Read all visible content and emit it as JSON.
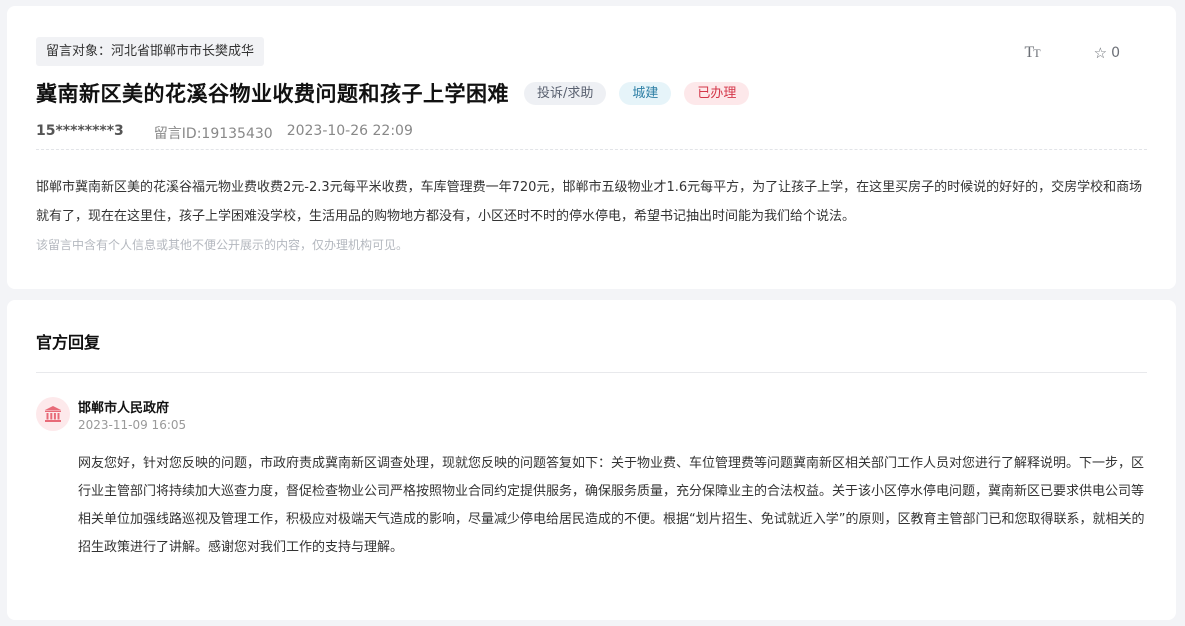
{
  "message": {
    "target": "留言对象：河北省邯郸市市长樊成华",
    "font_toggle": "TT",
    "favorite_count": "0",
    "title": "冀南新区美的花溪谷物业收费问题和孩子上学困难",
    "tags": {
      "type": "投诉/求助",
      "category": "城建",
      "status": "已办理"
    },
    "user": "15********3",
    "message_id": "留言ID:19135430",
    "datetime": "2023-10-26 22:09",
    "content": "邯郸市冀南新区美的花溪谷福元物业费收费2元-2.3元每平米收费，车库管理费一年720元，邯郸市五级物业才1.6元每平方，为了让孩子上学，在这里买房子的时候说的好好的，交房学校和商场就有了，现在在这里住，孩子上学困难没学校，生活用品的购物地方都没有，小区还时不时的停水停电，希望书记抽出时间能为我们给个说法。",
    "privacy_notice": "该留言中含有个人信息或其他不便公开展示的内容，仅办理机构可见。"
  },
  "reply": {
    "heading": "官方回复",
    "org_name": "邯郸市人民政府",
    "datetime": "2023-11-09 16:05",
    "content": "网友您好，针对您反映的问题，市政府责成冀南新区调查处理，现就您反映的问题答复如下：关于物业费、车位管理费等问题冀南新区相关部门工作人员对您进行了解释说明。下一步，区行业主管部门将持续加大巡查力度，督促检查物业公司严格按照物业合同约定提供服务，确保服务质量，充分保障业主的合法权益。关于该小区停水停电问题，冀南新区已要求供电公司等相关单位加强线路巡视及管理工作，积极应对极端天气造成的影响，尽量减少停电给居民造成的不便。根据“划片招生、免试就近入学”的原则，区教育主管部门已和您取得联系，就相关的招生政策进行了讲解。感谢您对我们工作的支持与理解。"
  },
  "icons": {
    "font_size": "font-size-icon",
    "favorite": "star-outline-icon",
    "org": "government-building-icon"
  },
  "colors": {
    "status_red": "#d4374a",
    "category_blue": "#2d7fa5",
    "org_icon_red": "#e86a78"
  }
}
